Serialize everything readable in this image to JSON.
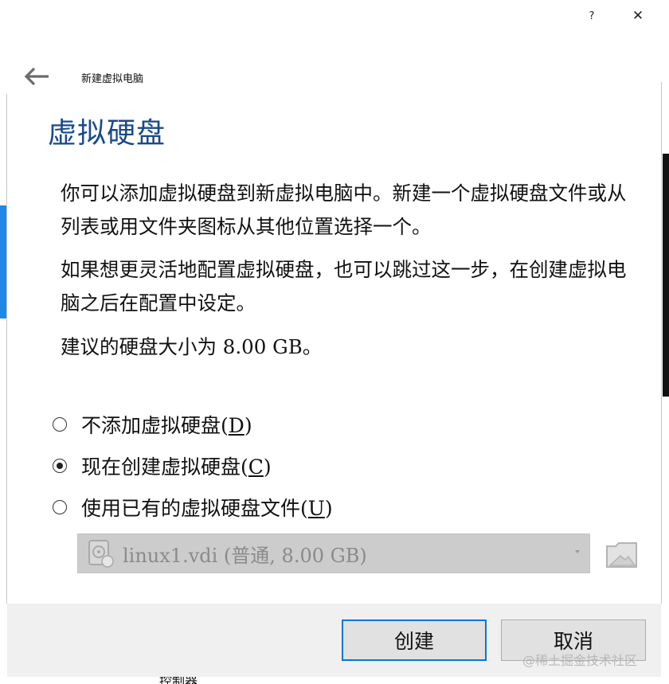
{
  "titlebar": {
    "help_label": "?",
    "close_label": "✕"
  },
  "nav": {
    "back_icon": "back-arrow-icon",
    "title": "新建虚拟电脑"
  },
  "page": {
    "heading": "虚拟硬盘",
    "para1": "你可以添加虚拟硬盘到新虚拟电脑中。新建一个虚拟硬盘文件或从列表或用文件夹图标从其他位置选择一个。",
    "para2": "如果想更灵活地配置虚拟硬盘，也可以跳过这一步，在创建虚拟电脑之后在配置中设定。",
    "para3": "建议的硬盘大小为 8.00 GB。"
  },
  "options": [
    {
      "label": "不添加虚拟硬盘(",
      "key": "D",
      "tail": ")",
      "checked": false
    },
    {
      "label": "现在创建虚拟硬盘(",
      "key": "C",
      "tail": ")",
      "checked": true
    },
    {
      "label": "使用已有的虚拟硬盘文件(",
      "key": "U",
      "tail": ")",
      "checked": false
    }
  ],
  "disk_select": {
    "value": "linux1.vdi (普通, 8.00 GB)",
    "enabled": false,
    "icon": "hard-disk-icon"
  },
  "folder_button_icon": "folder-icon",
  "buttons": {
    "create": "创建",
    "cancel": "取消"
  },
  "watermark": "@稀土掘金技术社区",
  "bottom_fragment": "控制器"
}
